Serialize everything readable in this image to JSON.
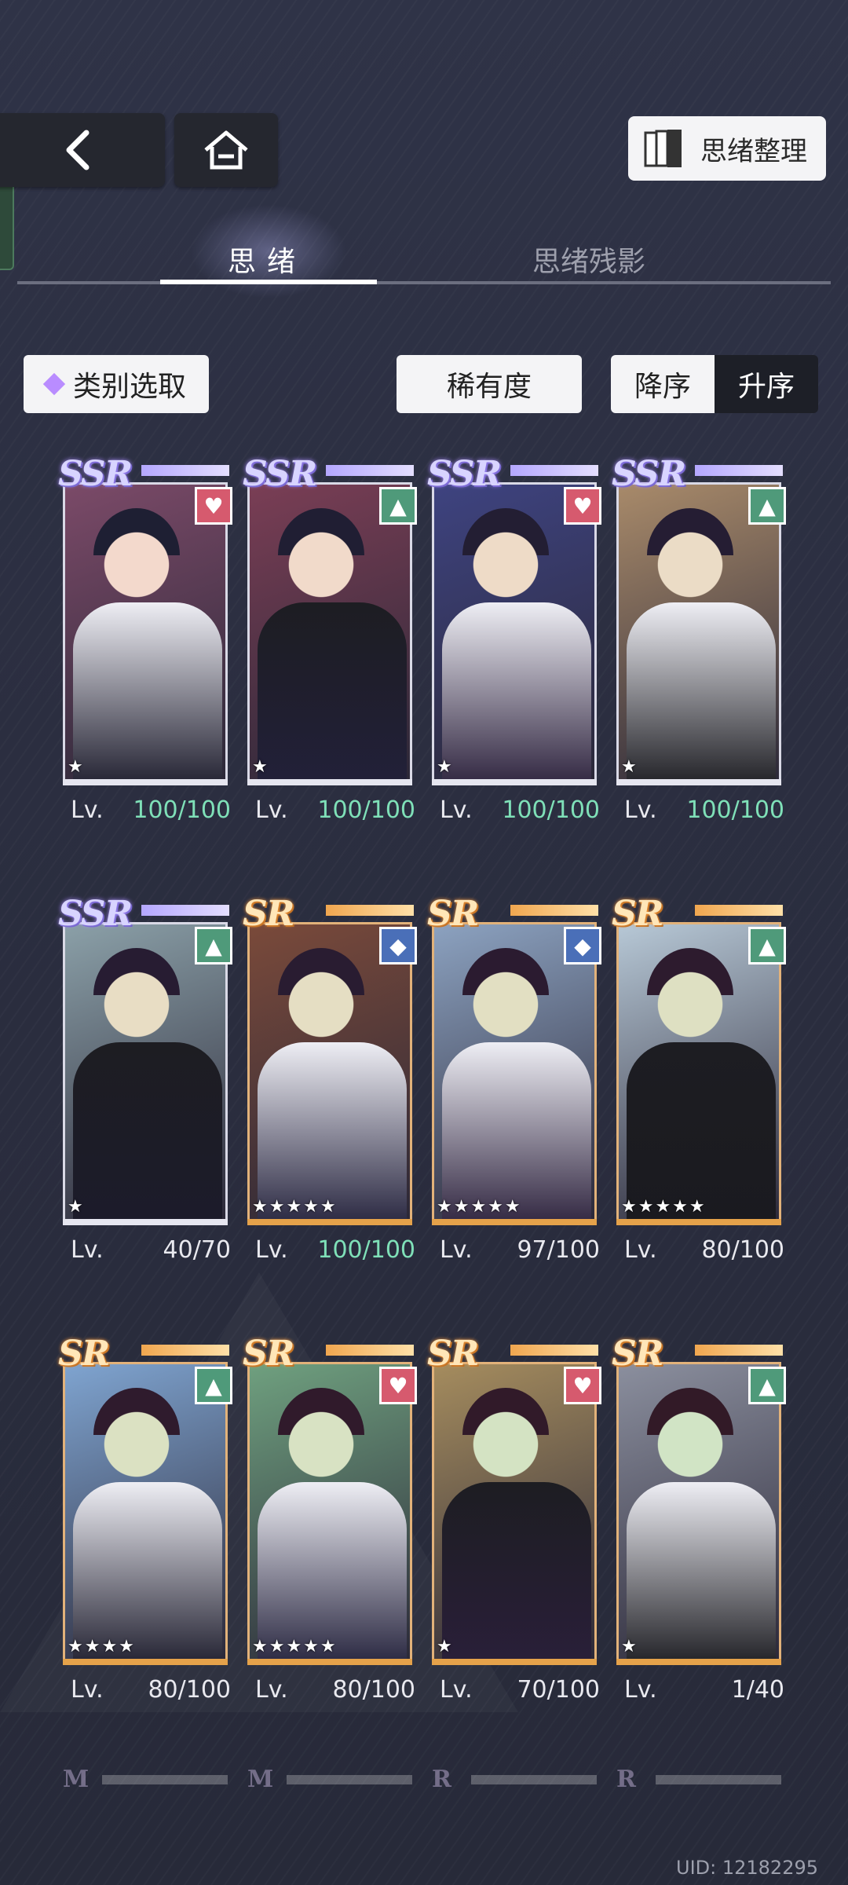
{
  "header": {
    "organize_label": "思绪整理",
    "back_icon": "chevron-left-icon",
    "home_icon": "home-icon",
    "organize_icon": "cards-stack-icon"
  },
  "tabs": [
    {
      "label": "思绪",
      "active": true
    },
    {
      "label": "思绪残影",
      "active": false
    }
  ],
  "filters": {
    "category_label": "类别选取",
    "rarity_label": "稀有度",
    "order_desc_label": "降序",
    "order_asc_label": "升序",
    "order_selected": "升序"
  },
  "cards": [
    {
      "rank": "SSR",
      "badge": "heart",
      "stars": "★",
      "lv_label": "Lv.",
      "level": "100/100",
      "maxed": true
    },
    {
      "rank": "SSR",
      "badge": "triangle",
      "stars": "★",
      "lv_label": "Lv.",
      "level": "100/100",
      "maxed": true
    },
    {
      "rank": "SSR",
      "badge": "heart",
      "stars": "★",
      "lv_label": "Lv.",
      "level": "100/100",
      "maxed": true
    },
    {
      "rank": "SSR",
      "badge": "triangle",
      "stars": "★",
      "lv_label": "Lv.",
      "level": "100/100",
      "maxed": true
    },
    {
      "rank": "SSR",
      "badge": "triangle",
      "stars": "★",
      "lv_label": "Lv.",
      "level": "40/70",
      "maxed": false
    },
    {
      "rank": "SR",
      "badge": "diamond",
      "stars": "★★★★★",
      "lv_label": "Lv.",
      "level": "100/100",
      "maxed": true
    },
    {
      "rank": "SR",
      "badge": "diamond",
      "stars": "★★★★★",
      "lv_label": "Lv.",
      "level": "97/100",
      "maxed": false
    },
    {
      "rank": "SR",
      "badge": "triangle",
      "stars": "★★★★★",
      "lv_label": "Lv.",
      "level": "80/100",
      "maxed": false
    },
    {
      "rank": "SR",
      "badge": "triangle",
      "stars": "★★★★",
      "lv_label": "Lv.",
      "level": "80/100",
      "maxed": false
    },
    {
      "rank": "SR",
      "badge": "heart",
      "stars": "★★★★★",
      "lv_label": "Lv.",
      "level": "80/100",
      "maxed": false
    },
    {
      "rank": "SR",
      "badge": "heart",
      "stars": "★",
      "lv_label": "Lv.",
      "level": "70/100",
      "maxed": false
    },
    {
      "rank": "SR",
      "badge": "triangle",
      "stars": "★",
      "lv_label": "Lv.",
      "level": "1/40",
      "maxed": false
    }
  ],
  "partial_row_ranks": [
    "M",
    "M",
    "R",
    "R"
  ],
  "footer": {
    "uid": "UID: 12182295"
  },
  "colors": {
    "ssr_accent": "#a98bff",
    "sr_accent": "#e5a24a",
    "maxed_level": "#7fe0b8",
    "heart_badge": "#d65a6e",
    "triangle_badge": "#4f9a7a",
    "diamond_badge": "#4a6fb8"
  }
}
